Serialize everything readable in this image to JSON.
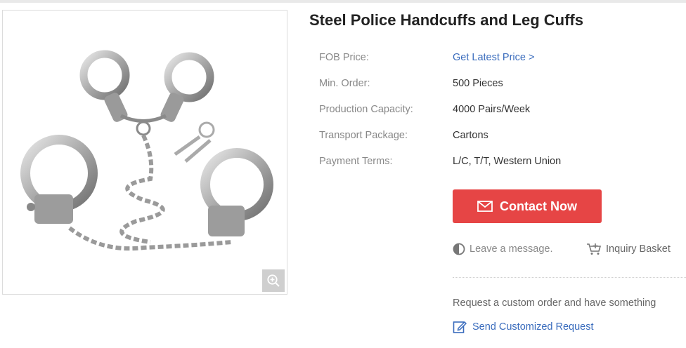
{
  "product": {
    "title": "Steel Police Handcuffs and Leg Cuffs"
  },
  "specs": [
    {
      "label": "FOB Price:",
      "value": "Get Latest Price >"
    },
    {
      "label": "Min. Order:",
      "value": "500 Pieces"
    },
    {
      "label": "Production Capacity:",
      "value": "4000 Pairs/Week"
    },
    {
      "label": "Transport Package:",
      "value": "Cartons"
    },
    {
      "label": "Payment Terms:",
      "value": "L/C, T/T, Western Union"
    }
  ],
  "actions": {
    "contact_label": "Contact Now",
    "leave_message": "Leave a message.",
    "inquiry_basket": "Inquiry Basket",
    "custom_text": "Request a custom order and have something",
    "send_request": "Send Customized Request"
  },
  "colors": {
    "accent": "#e64545",
    "link": "#3a6cbd",
    "label": "#888888"
  },
  "icons": {
    "zoom": "zoom-in-icon",
    "contact": "envelope-icon",
    "leave": "half-circle-icon",
    "basket": "cart-plus-icon",
    "send": "edit-icon"
  }
}
